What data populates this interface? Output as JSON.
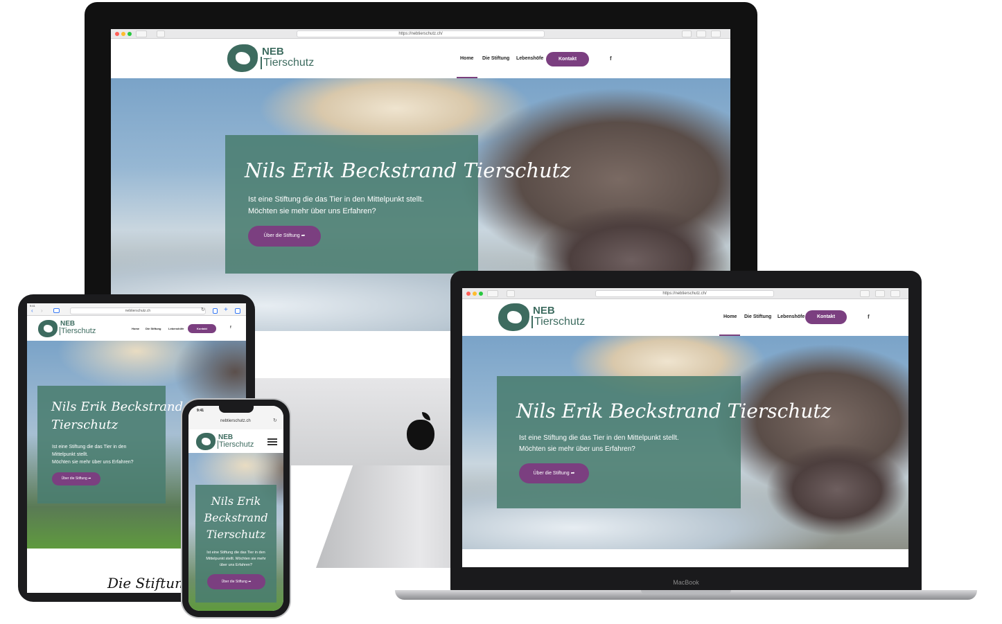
{
  "site": {
    "logo_neb": "NEB",
    "logo_sub": "Tierschutz",
    "nav": [
      "Home",
      "Die Stiftung",
      "Lebenshöfe"
    ],
    "contact_label": "Kontakt",
    "facebook": "f",
    "hero_title": "Nils Erik Beckstrand Tierschutz",
    "hero_title_tablet_1": "Nils Erik Beckstrand",
    "hero_title_tablet_2": "Tierschutz",
    "hero_title_phone_1": "Nils Erik",
    "hero_title_phone_2": "Beckstrand",
    "hero_title_phone_3": "Tierschutz",
    "hero_line1": "Ist eine Stiftung die das Tier in den Mittelpunkt stellt.",
    "hero_line2": "Möchten sie mehr über uns Erfahren?",
    "hero_tablet_1": "Ist eine Stiftung die das Tier in den",
    "hero_tablet_2": "Mittelpunkt stellt.",
    "hero_tablet_3": "Möchten sie mehr über uns Erfahren?",
    "hero_phone_text": "Ist eine Stiftung die das Tier in den Mittelpunkt stellt. Möchten sie mehr über uns Erfahren?",
    "hero_button": "Über die Stiftung ➦",
    "section_heading": "Die Stiftung"
  },
  "browsers": {
    "imac_url": "https://nebtierschutz.ch/",
    "macbook_url": "https://nebtierschutz.ch/",
    "ipad_url": "nebtierschutz.ch",
    "ipad_time": "9:41",
    "phone_url": "nebtierschutz.ch",
    "phone_time": "9:41",
    "reload_icon": "↻"
  },
  "devices": {
    "macbook_label": "MacBook"
  },
  "colors": {
    "brand_green": "#3d6b5f",
    "hero_panel": "#4a7d70",
    "accent_purple": "#7b3f80"
  },
  "icons": [
    "traffic-lights",
    "back-icon",
    "forward-icon",
    "sidebar-icon",
    "reload-icon",
    "share-icon",
    "tabs-icon",
    "facebook-icon",
    "hamburger-menu-icon",
    "apple-logo-icon",
    "arrow-icon"
  ]
}
